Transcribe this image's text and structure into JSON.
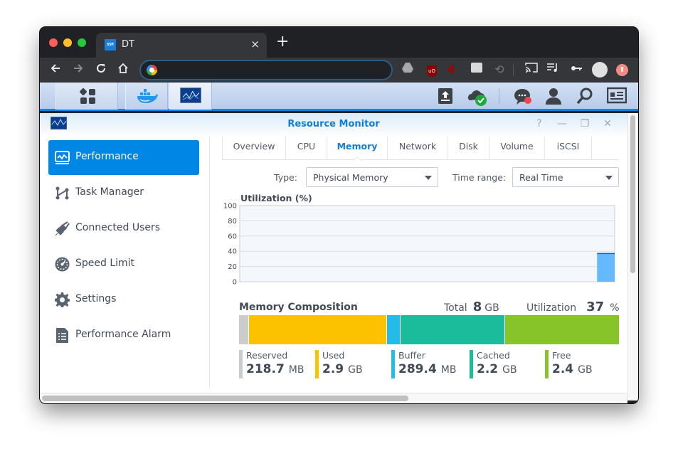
{
  "browser": {
    "tab": {
      "title": "DT",
      "favicon_text": "DSM",
      "close_icon": "×"
    },
    "new_tab_icon": "+",
    "omnibox": {
      "value": "",
      "placeholder": ""
    },
    "extensions": {
      "count_badge": "4",
      "ublock_text": "uO"
    }
  },
  "dsm": {
    "taskbar": {
      "items": [
        "main-menu",
        "docker",
        "resource-monitor"
      ],
      "right_icons": [
        "upload",
        "cloud-sync",
        "notifications",
        "user",
        "search",
        "widgets"
      ]
    },
    "app": {
      "title": "Resource Monitor",
      "window_controls": {
        "help": "?",
        "minimize": "—",
        "maximize": "❐",
        "close": "✕"
      },
      "sidebar": {
        "items": [
          {
            "label": "Performance",
            "icon": "performance-icon",
            "active": true
          },
          {
            "label": "Task Manager",
            "icon": "task-manager-icon",
            "active": false
          },
          {
            "label": "Connected Users",
            "icon": "plug-icon",
            "active": false
          },
          {
            "label": "Speed Limit",
            "icon": "speedometer-icon",
            "active": false
          },
          {
            "label": "Settings",
            "icon": "gear-icon",
            "active": false
          },
          {
            "label": "Performance Alarm",
            "icon": "document-list-icon",
            "active": false
          }
        ]
      },
      "tabs": [
        {
          "label": "Overview",
          "active": false
        },
        {
          "label": "CPU",
          "active": false
        },
        {
          "label": "Memory",
          "active": true
        },
        {
          "label": "Network",
          "active": false
        },
        {
          "label": "Disk",
          "active": false
        },
        {
          "label": "Volume",
          "active": false
        },
        {
          "label": "iSCSI",
          "active": false
        }
      ],
      "filters": {
        "type_label": "Type:",
        "type_value": "Physical Memory",
        "time_range_label": "Time range:",
        "time_range_value": "Real Time"
      },
      "memory_composition": {
        "title": "Memory Composition",
        "total_label": "Total",
        "total_value": "8",
        "total_unit": "GB",
        "utilization_label": "Utilization",
        "utilization_value": "37",
        "utilization_unit": "%",
        "segments": [
          {
            "name": "Reserved",
            "value": "218.7",
            "unit": "MB",
            "color": "#cccccc",
            "share": 0.027
          },
          {
            "name": "Used",
            "value": "2.9",
            "unit": "GB",
            "color": "#fcc200",
            "share": 0.362
          },
          {
            "name": "Buffer",
            "value": "289.4",
            "unit": "MB",
            "color": "#23bbe8",
            "share": 0.036
          },
          {
            "name": "Cached",
            "value": "2.2",
            "unit": "GB",
            "color": "#1abc9c",
            "share": 0.275
          },
          {
            "name": "Free",
            "value": "2.4",
            "unit": "GB",
            "color": "#86c42a",
            "share": 0.3
          }
        ]
      }
    }
  },
  "chart_data": {
    "type": "area",
    "title": "Utilization (%)",
    "xlabel": "",
    "ylabel": "Utilization (%)",
    "ylim": [
      0,
      100
    ],
    "yticks": [
      0,
      20,
      40,
      60,
      80,
      100
    ],
    "grid": true,
    "series": [
      {
        "name": "Physical Memory",
        "color": "#66b8ff",
        "x_fraction_start": 0.953,
        "values": [
          37
        ]
      }
    ]
  }
}
